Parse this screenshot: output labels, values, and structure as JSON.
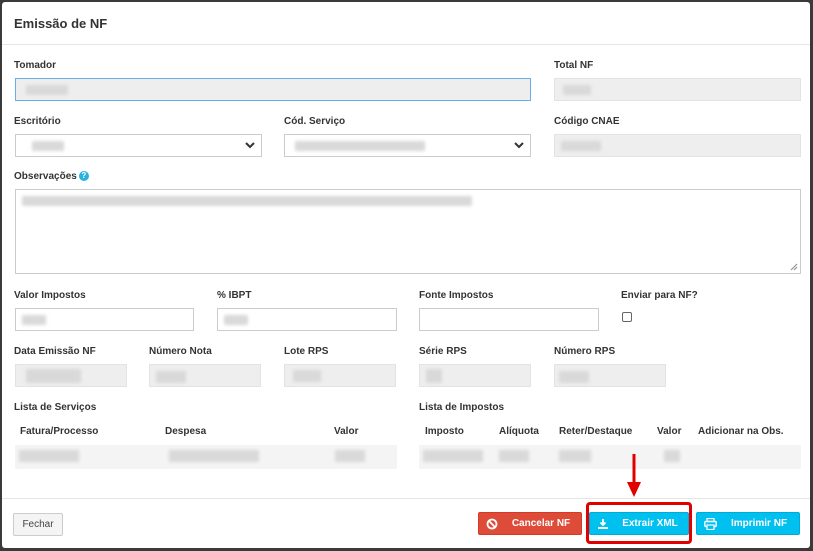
{
  "dialog": {
    "title": "Emissão de NF"
  },
  "fields": {
    "tomador": "Tomador",
    "total_nf": "Total NF",
    "escritorio": "Escritório",
    "cod_servico": "Cód. Serviço",
    "codigo_cnae": "Código CNAE",
    "observacoes": "Observações",
    "help_glyph": "?",
    "valor_impostos": "Valor Impostos",
    "pct_ibpt": "% IBPT",
    "fonte_impostos": "Fonte Impostos",
    "enviar_para_nf": "Enviar para NF?",
    "data_emissao_nf": "Data Emissão NF",
    "numero_nota": "Número Nota",
    "lote_rps": "Lote RPS",
    "serie_rps": "Série RPS",
    "numero_rps": "Número RPS"
  },
  "servicos": {
    "title": "Lista de Serviços",
    "columns": [
      "Fatura/Processo",
      "Despesa",
      "Valor"
    ]
  },
  "impostos": {
    "title": "Lista de Impostos",
    "columns": [
      "Imposto",
      "Alíquota",
      "Reter/Destaque",
      "Valor",
      "Adicionar na Obs."
    ]
  },
  "footer": {
    "close": "Fechar",
    "cancel": "Cancelar NF",
    "extract": "Extrair XML",
    "print": "Imprimir NF"
  },
  "colors": {
    "danger": "#dd4b39",
    "info": "#00c0ef",
    "annotation": "#e00000"
  },
  "icons": {
    "cancel": "ban-icon",
    "extract": "download-icon",
    "print": "print-icon",
    "help": "question-circle-icon"
  }
}
